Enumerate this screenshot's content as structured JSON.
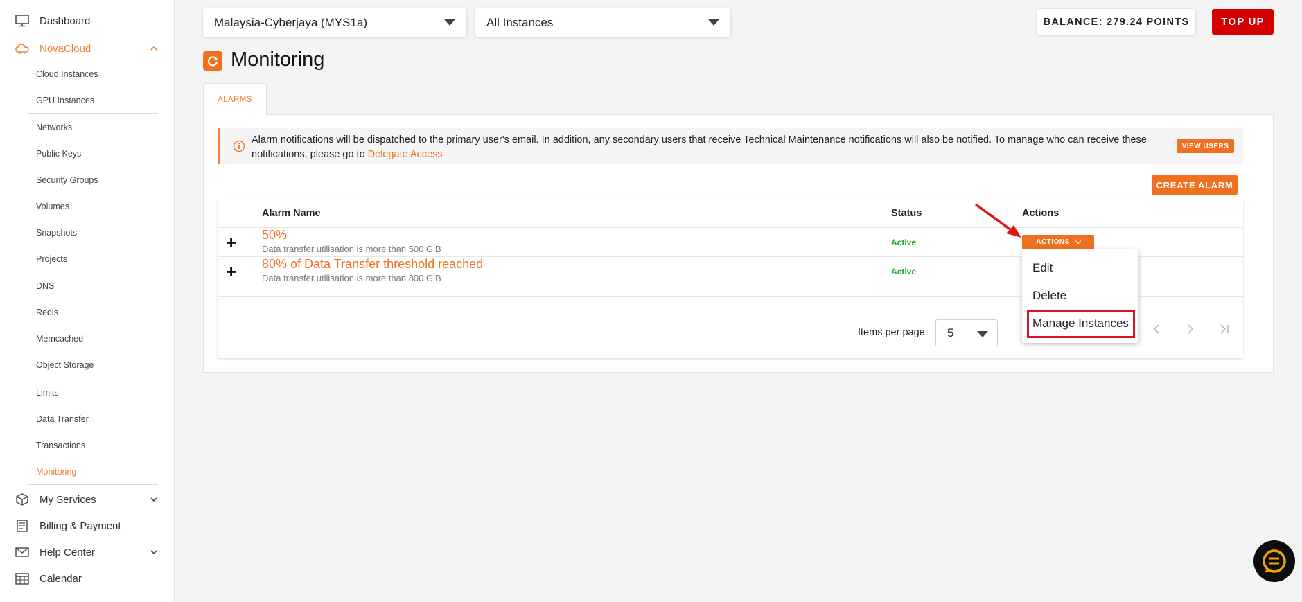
{
  "sidebar": {
    "dashboard": "Dashboard",
    "novacloud": "NovaCloud",
    "subitems": [
      "Cloud Instances",
      "GPU Instances",
      "Networks",
      "Public Keys",
      "Security Groups",
      "Volumes",
      "Snapshots",
      "Projects",
      "DNS",
      "Redis",
      "Memcached",
      "Object Storage",
      "Limits",
      "Data Transfer",
      "Transactions",
      "Monitoring"
    ],
    "my_services": "My Services",
    "billing": "Billing & Payment",
    "help": "Help Center",
    "calendar": "Calendar",
    "accent": "#f08030"
  },
  "topbar": {
    "region": "Malaysia-Cyberjaya (MYS1a)",
    "instances": "All Instances",
    "balance": "BALANCE: 279.24 POINTS",
    "topup": "TOP UP"
  },
  "page": {
    "title": "Monitoring",
    "tab": "ALARMS",
    "notice_text": "Alarm notifications will be dispatched to the primary user's email. In addition, any secondary users that receive Technical Maintenance notifications will also be notified. To manage who can receive these notifications, please go to ",
    "notice_link": "Delegate Access",
    "view_users": "VIEW USERS",
    "create_alarm": "CREATE ALARM"
  },
  "table": {
    "headers": {
      "name": "Alarm Name",
      "status": "Status",
      "actions": "Actions"
    },
    "rows": [
      {
        "expand": "+",
        "name": "50%",
        "desc": "Data transfer utilisation is more than 500 GiB",
        "status": "Active"
      },
      {
        "expand": "+",
        "name": "80% of Data Transfer threshold reached",
        "desc": "Data transfer utilisation is more than 800 GiB",
        "status": "Active"
      }
    ],
    "actions_label": "ACTIONS",
    "menu": [
      "Edit",
      "Delete",
      "Manage Instances"
    ],
    "items_per_page_label": "Items per page:",
    "items_per_page": "5"
  }
}
